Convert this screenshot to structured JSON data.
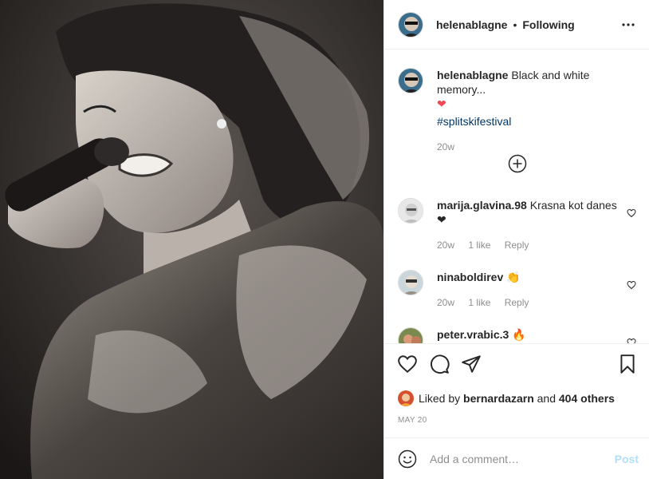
{
  "post": {
    "author": "helenablagne",
    "follow_status": "Following",
    "separator": "•",
    "caption_text": "Black and white memory...",
    "caption_emoji": "❤",
    "hashtag": "#splitskifestival",
    "caption_age": "20w"
  },
  "comments": [
    {
      "user": "marija.glavina.98",
      "text": "Krasna kot danes",
      "emoji": "❤",
      "age": "20w",
      "likes": "1 like",
      "reply": "Reply"
    },
    {
      "user": "ninaboldirev",
      "text": "",
      "emoji": "👏",
      "age": "20w",
      "likes": "1 like",
      "reply": "Reply"
    },
    {
      "user": "peter.vrabic.3",
      "text": "",
      "emoji": "🔥",
      "age": "",
      "likes": "",
      "reply": ""
    }
  ],
  "likes": {
    "prefix": "Liked by",
    "user": "bernardazarn",
    "middle": "and",
    "others": "404 others"
  },
  "date": "MAY 20",
  "add_comment": {
    "placeholder": "Add a comment…",
    "post_label": "Post"
  },
  "icons": {
    "more": "more-options-icon",
    "load_more": "load-more-comments-icon",
    "like": "heart-icon",
    "comment": "comment-icon",
    "share": "share-icon",
    "save": "bookmark-icon",
    "emoji": "emoji-icon"
  },
  "colors": {
    "link": "#00376b",
    "meta": "#8e8e8e",
    "post_button": "#b2dffc",
    "heart": "#ed4956"
  }
}
